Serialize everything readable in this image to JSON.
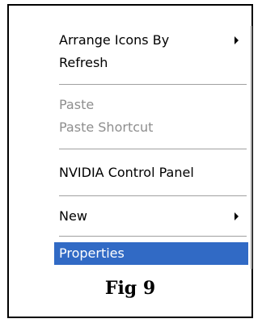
{
  "context_menu": {
    "items": [
      {
        "label": "Arrange Icons By",
        "has_submenu": true,
        "disabled": false,
        "selected": false
      },
      {
        "label": "Refresh",
        "has_submenu": false,
        "disabled": false,
        "selected": false
      },
      {
        "label": "Paste",
        "has_submenu": false,
        "disabled": true,
        "selected": false
      },
      {
        "label": "Paste Shortcut",
        "has_submenu": false,
        "disabled": true,
        "selected": false
      },
      {
        "label": "NVIDIA Control Panel",
        "has_submenu": false,
        "disabled": false,
        "selected": false
      },
      {
        "label": "New",
        "has_submenu": true,
        "disabled": false,
        "selected": false
      },
      {
        "label": "Properties",
        "has_submenu": false,
        "disabled": false,
        "selected": true
      }
    ],
    "selection_color": "#316ac5",
    "disabled_text_color": "#8e8e8e"
  },
  "caption": "Fig 9"
}
